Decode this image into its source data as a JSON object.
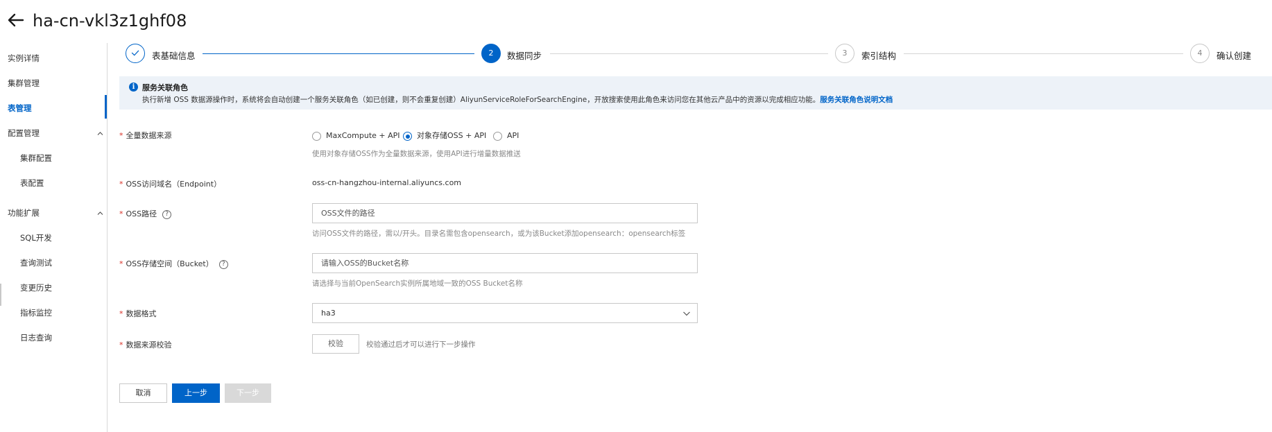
{
  "header": {
    "title": "ha-cn-vkl3z1ghf08",
    "back_icon": "arrow-left-icon"
  },
  "sidebar": {
    "items": [
      {
        "label": "实例详情"
      },
      {
        "label": "集群管理"
      },
      {
        "label": "表管理",
        "active": true
      }
    ],
    "config_group": {
      "label": "配置管理",
      "children": [
        {
          "label": "集群配置"
        },
        {
          "label": "表配置"
        }
      ]
    },
    "extension_group": {
      "label": "功能扩展",
      "children": [
        {
          "label": "SQL开发"
        },
        {
          "label": "查询测试"
        },
        {
          "label": "变更历史"
        },
        {
          "label": "指标监控"
        },
        {
          "label": "日志查询"
        }
      ]
    }
  },
  "steps": [
    {
      "number": "1",
      "label": "表基础信息",
      "state": "done"
    },
    {
      "number": "2",
      "label": "数据同步",
      "state": "current"
    },
    {
      "number": "3",
      "label": "索引结构",
      "state": "todo"
    },
    {
      "number": "4",
      "label": "确认创建",
      "state": "todo"
    }
  ],
  "notice": {
    "icon": "info-icon",
    "title": "服务关联角色",
    "text": "执行新增 OSS 数据源操作时，系统将会自动创建一个服务关联角色（如已创建，则不会重复创建）AliyunServiceRoleForSearchEngine，开放搜索使用此角色来访问您在其他云产品中的资源以完成相应功能。",
    "link": "服务关联角色说明文档"
  },
  "form": {
    "source": {
      "label": "全量数据来源",
      "options": [
        "MaxCompute + API",
        "对象存储OSS + API",
        "API"
      ],
      "selected": "对象存储OSS + API",
      "hint": "使用对象存储OSS作为全量数据来源，使用API进行增量数据推送"
    },
    "endpoint": {
      "label": "OSS访问域名（Endpoint）",
      "value": "oss-cn-hangzhou-internal.aliyuncs.com"
    },
    "path": {
      "label": "OSS路径",
      "placeholder": "OSS文件的路径",
      "hint": "访问OSS文件的路径，需以/开头。目录名需包含opensearch，或为该Bucket添加opensearch：opensearch标签"
    },
    "bucket": {
      "label": "OSS存储空间（Bucket）",
      "placeholder": "请输入OSS的Bucket名称",
      "hint": "请选择与当前OpenSearch实例所属地域一致的OSS Bucket名称"
    },
    "format": {
      "label": "数据格式",
      "value": "ha3"
    },
    "verify": {
      "label": "数据来源校验",
      "button": "校验",
      "hint": "校验通过后才可以进行下一步操作"
    }
  },
  "footer": {
    "cancel": "取消",
    "prev": "上一步",
    "next": "下一步"
  },
  "colors": {
    "primary": "#0064c8",
    "required": "#d93026",
    "notice_bg": "#edf2f8",
    "disabled": "#d9d9d9"
  }
}
